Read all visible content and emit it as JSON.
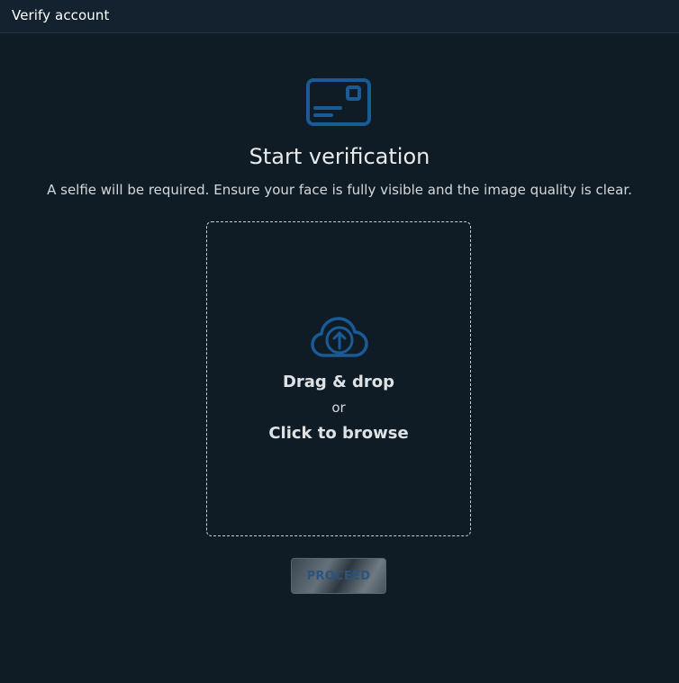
{
  "window": {
    "title": "Verify account"
  },
  "main": {
    "heading": "Start verification",
    "subtitle": "A selfie will be required. Ensure your face is fully visible and the image quality is clear.",
    "header_icon": "id-card-icon"
  },
  "dropzone": {
    "icon": "cloud-upload-icon",
    "drag_label": "Drag & drop",
    "or_label": "or",
    "browse_label": "Click to browse"
  },
  "actions": {
    "proceed_label": "PROCEED",
    "proceed_state": "disabled"
  },
  "colors": {
    "background": "#0f1c26",
    "titlebar": "#13222e",
    "accent_icon": "#1a5a96",
    "text": "#e6e8ea"
  }
}
